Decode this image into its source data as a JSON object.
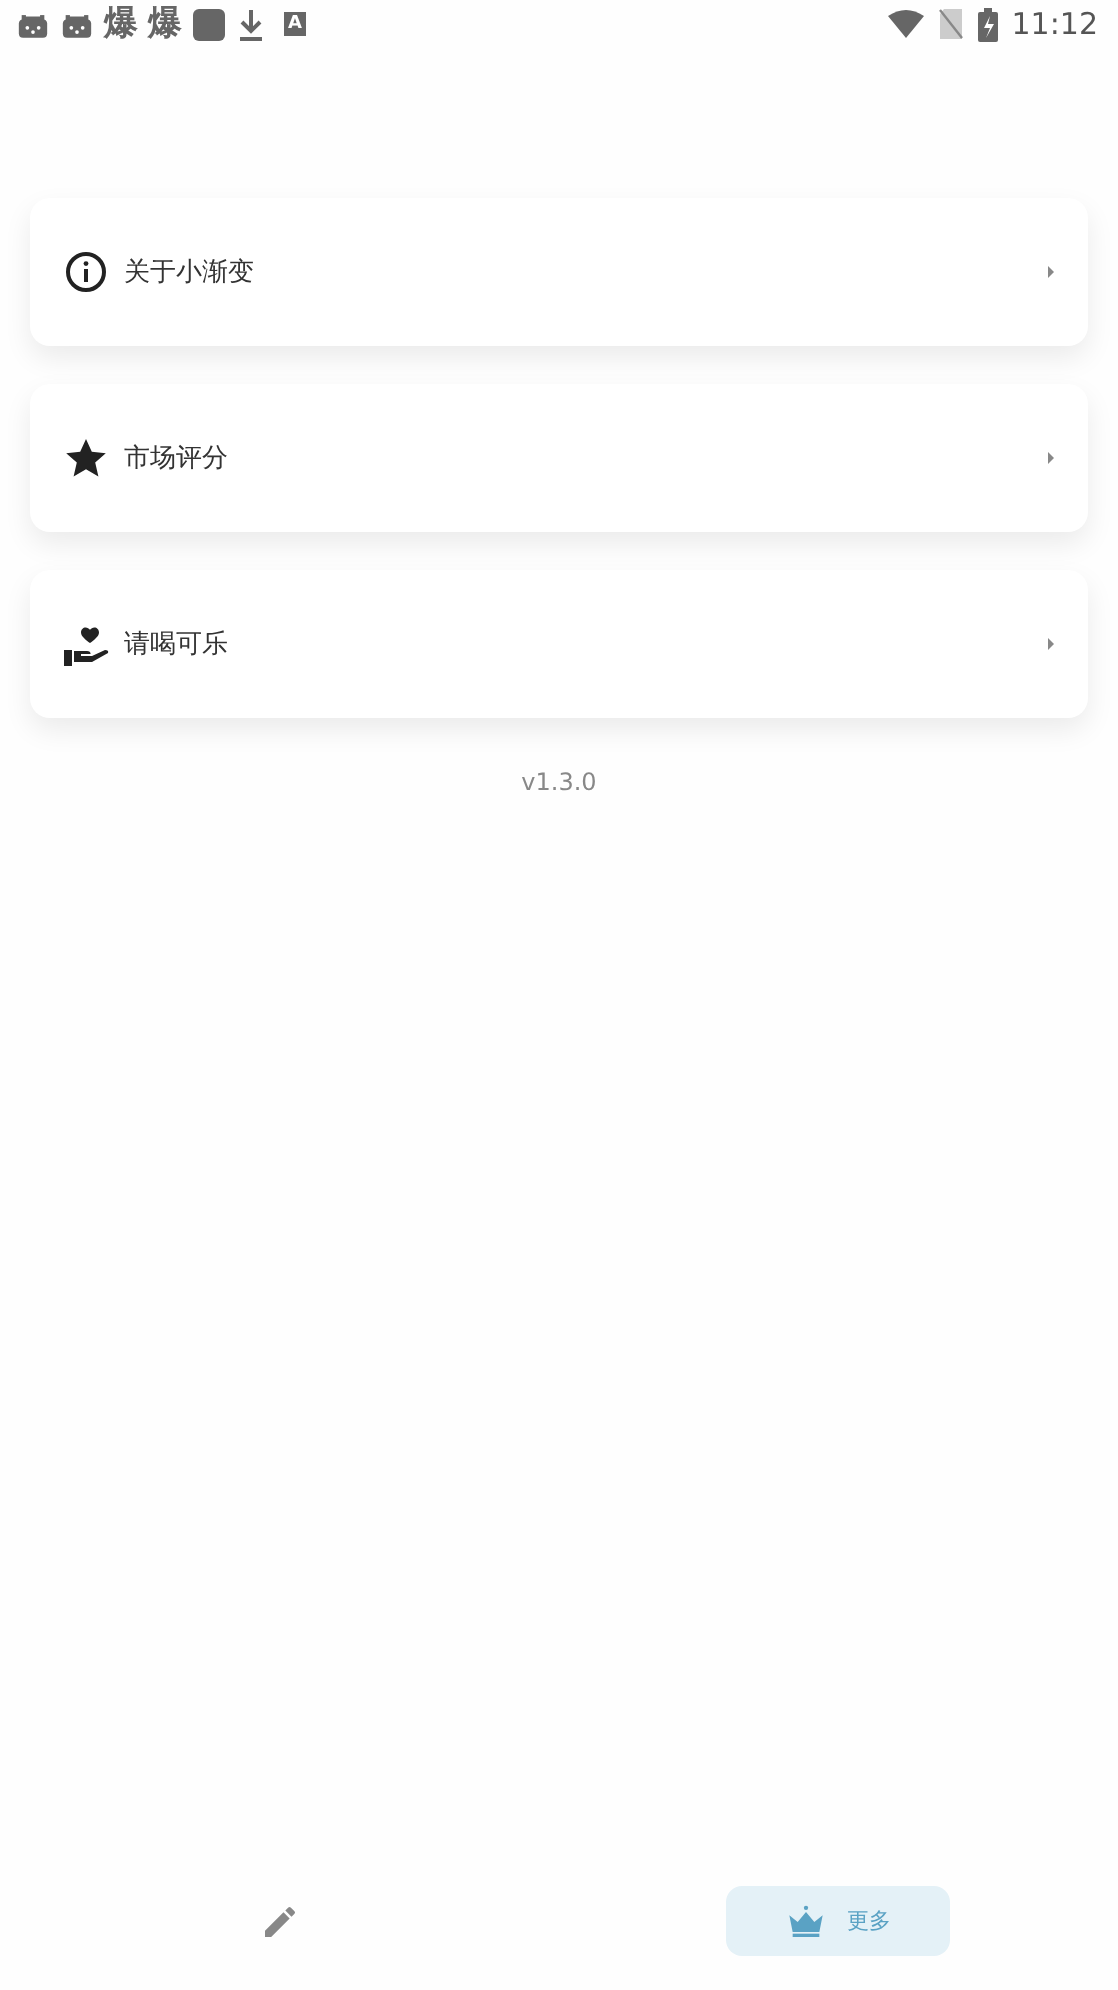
{
  "status_bar": {
    "notifications": [
      {
        "kind": "gamepad"
      },
      {
        "kind": "gamepad"
      },
      {
        "kind": "glyph",
        "text": "爆"
      },
      {
        "kind": "glyph",
        "text": "爆"
      },
      {
        "kind": "square"
      },
      {
        "kind": "download"
      },
      {
        "kind": "letter",
        "text": "A"
      }
    ],
    "time": "11:12"
  },
  "menu": [
    {
      "kind": "info",
      "label": "关于小渐变"
    },
    {
      "kind": "star",
      "label": "市场评分"
    },
    {
      "kind": "donate",
      "label": "请喝可乐"
    }
  ],
  "version": "v1.3.0",
  "bottom_nav": [
    {
      "kind": "pencil",
      "selected": false
    },
    {
      "kind": "crown",
      "label": "更多",
      "selected": true
    }
  ]
}
